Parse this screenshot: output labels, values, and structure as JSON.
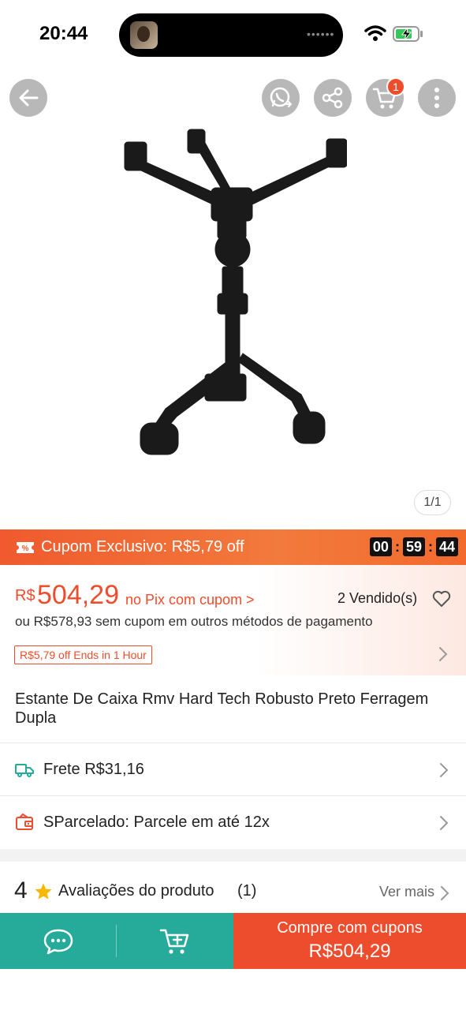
{
  "status_bar": {
    "time": "20:44",
    "island_indicator": "••••••"
  },
  "product_image": {
    "page_indicator": "1/1"
  },
  "header_buttons": {
    "cart_badge": "1",
    "icons": [
      "back-arrow-icon",
      "whatsapp-share-icon",
      "share-icon",
      "cart-icon",
      "more-vertical-icon"
    ]
  },
  "coupon": {
    "text": "Cupom Exclusivo: R$5,79 off",
    "countdown": {
      "hours": "00",
      "minutes": "59",
      "seconds": "44",
      "sep": ":"
    }
  },
  "price": {
    "currency": "R$",
    "amount": "504,29",
    "pix_link": "no Pix com cupom >",
    "sold": "2 Vendido(s)",
    "alt_price": "ou R$578,93 sem cupom em outros métodos de pagamento",
    "offer_tag": "R$5,79 off Ends in 1 Hour"
  },
  "product": {
    "title": "Estante De Caixa Rmv Hard Tech Robusto Preto Ferragem Dupla"
  },
  "shipping": {
    "label": "Frete R$31,16"
  },
  "installments": {
    "label": "SParcelado: Parcele em até 12x"
  },
  "reviews": {
    "rating": "4",
    "label": "Avaliações do produto",
    "count": "(1)",
    "see_more": "Ver mais"
  },
  "bottom_bar": {
    "buy_label": "Compre com cupons",
    "buy_price": "R$504,29"
  },
  "colors": {
    "brand_orange": "#ee4d2d",
    "teal": "#26aa99",
    "countdown_bg": "#111111"
  }
}
